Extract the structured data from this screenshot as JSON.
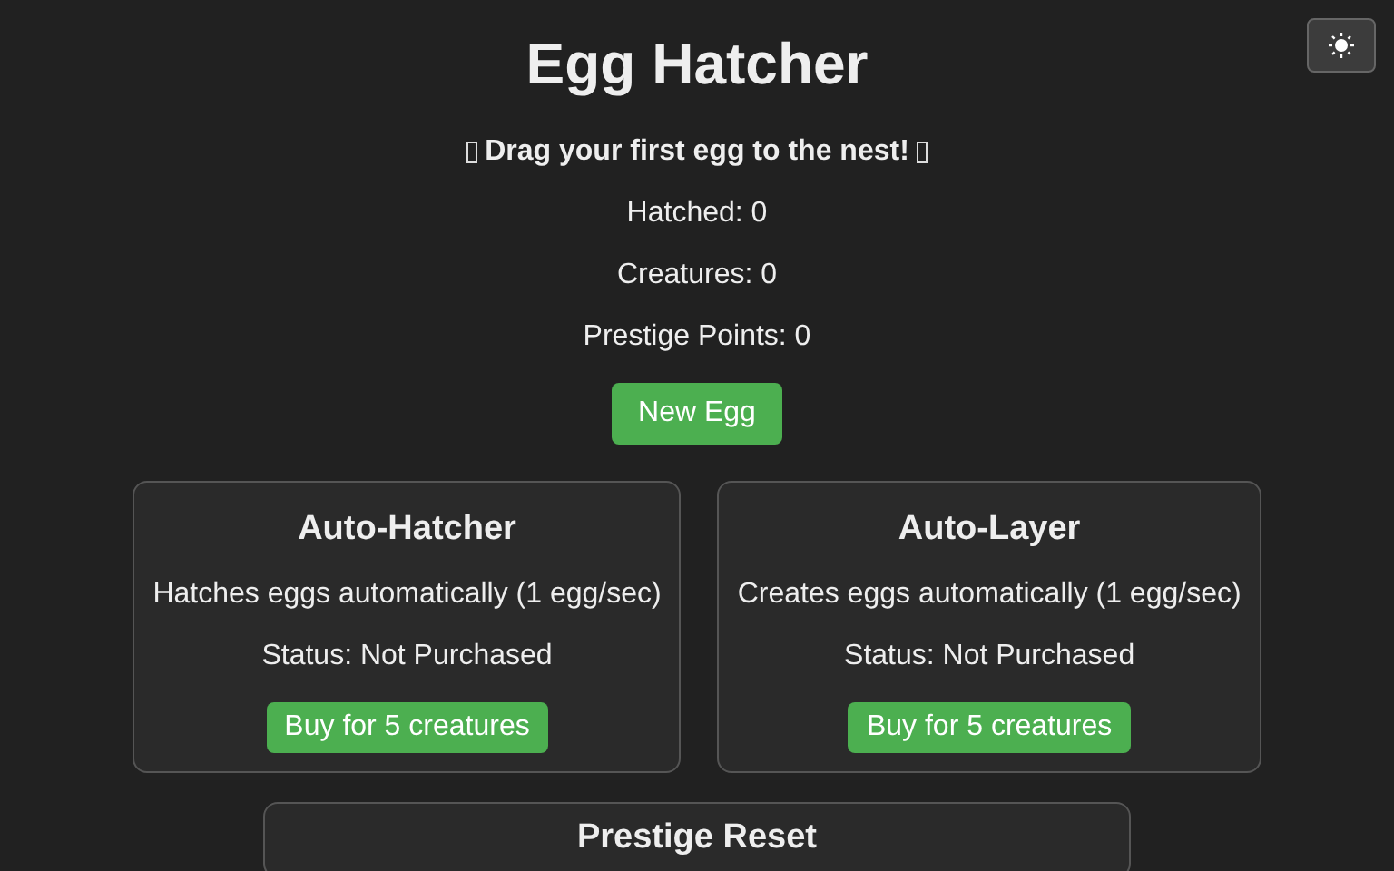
{
  "title": "Egg Hatcher",
  "hint": "Drag your first egg to the nest!",
  "stats": [
    "Hatched: 0",
    "Creatures: 0",
    "Prestige Points: 0"
  ],
  "new_egg_button": "New Egg",
  "upgrades": [
    {
      "title": "Auto-Hatcher",
      "description": "Hatches eggs automatically (1 egg/sec)",
      "status": "Status: Not Purchased",
      "button": "Buy for 5 creatures"
    },
    {
      "title": "Auto-Layer",
      "description": "Creates eggs automatically (1 egg/sec)",
      "status": "Status: Not Purchased",
      "button": "Buy for 5 creatures"
    }
  ],
  "prestige": {
    "title": "Prestige Reset"
  }
}
